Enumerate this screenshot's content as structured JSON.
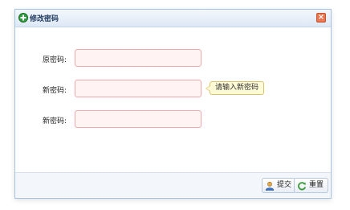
{
  "dialog": {
    "title": "修改密码",
    "close_label": "×"
  },
  "form": {
    "old_password_label": "原密码:",
    "new_password_label": "新密码:",
    "confirm_password_label": "新密码:",
    "old_password_value": "",
    "new_password_value": "",
    "confirm_password_value": ""
  },
  "tooltip": {
    "text": "请输入新密码"
  },
  "footer": {
    "submit_label": "提交",
    "reset_label": "重置"
  },
  "icons": {
    "title": "add-circle-icon",
    "close": "close-icon",
    "submit": "user-icon",
    "reset": "refresh-icon"
  },
  "colors": {
    "title_bg": "#dde8f5",
    "field_border": "#f2a9a9",
    "field_bg": "#fff3f3",
    "tooltip_bg": "#fffbd6",
    "close_bg": "#e8764f"
  }
}
